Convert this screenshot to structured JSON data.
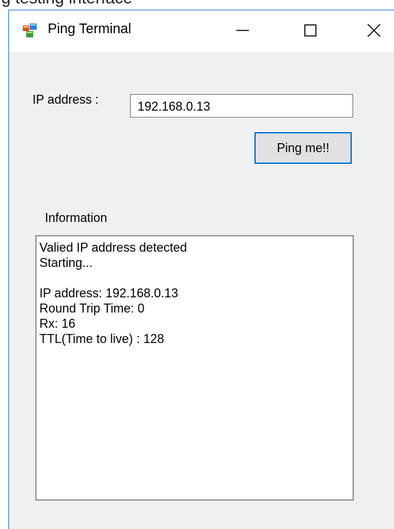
{
  "caption_fragment": "g testing interface",
  "window": {
    "title": "Ping Terminal",
    "icons": {
      "app": "app-window-icon",
      "minimize": "minimize-icon",
      "maximize": "maximize-icon",
      "close": "close-icon"
    }
  },
  "form": {
    "ip_label": "IP address :",
    "ip_value": "192.168.0.13",
    "ping_button_label": "Ping me!!"
  },
  "info": {
    "label": "Information",
    "lines": [
      "Valied IP address detected",
      "Starting...",
      "",
      "IP address: 192.168.0.13",
      "Round Trip Time: 0",
      "Rx: 16",
      "TTL(Time to live) : 128"
    ]
  },
  "colors": {
    "window_bg": "#f0f0f0",
    "focus_border": "#0a78d7",
    "button_bg": "#e1e1e1"
  }
}
